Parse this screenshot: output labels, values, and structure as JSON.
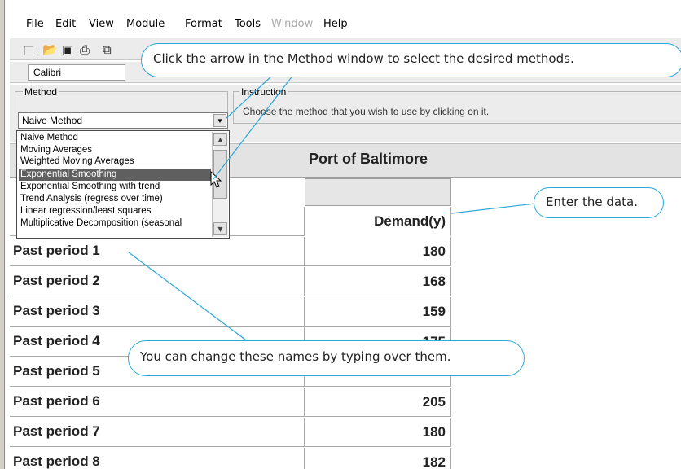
{
  "menu": [
    "File",
    "Edit",
    "View",
    "Module",
    "Format",
    "Tools",
    "Window",
    "Help"
  ],
  "menu_disabled": [
    "Window"
  ],
  "toolbar": {
    "font_name": "Calibri"
  },
  "method_panel": {
    "label": "Method",
    "selected": "Naive Method",
    "options": [
      "Naive Method",
      "Moving Averages",
      "Weighted Moving Averages",
      "Exponential Smoothing",
      "Exponential Smoothing with trend",
      "Trend Analysis (regress over time)",
      "Linear regression/least squares",
      "Multiplicative Decomposition (seasonal"
    ],
    "highlighted": "Exponential Smoothing"
  },
  "instruction_panel": {
    "label": "Instruction",
    "text": "Choose the method that you wish to use by clicking on it."
  },
  "sheet": {
    "title": "Port of Baltimore",
    "column_header": "Demand(y)",
    "rows": [
      {
        "name": "Past period 1",
        "demand": "180"
      },
      {
        "name": "Past period 2",
        "demand": "168"
      },
      {
        "name": "Past period 3",
        "demand": "159"
      },
      {
        "name": "Past period 4",
        "demand": "175"
      },
      {
        "name": "Past period 5",
        "demand": ""
      },
      {
        "name": "Past period 6",
        "demand": "205"
      },
      {
        "name": "Past period 7",
        "demand": "180"
      },
      {
        "name": "Past period 8",
        "demand": "182"
      }
    ]
  },
  "callouts": {
    "method": "Click the arrow in the Method window to select the desired methods.",
    "data": "Enter the data.",
    "names": "You can change these names by typing over them."
  },
  "colors": {
    "callout_border": "#2aa8d8",
    "selection": "#5f5f5f"
  }
}
